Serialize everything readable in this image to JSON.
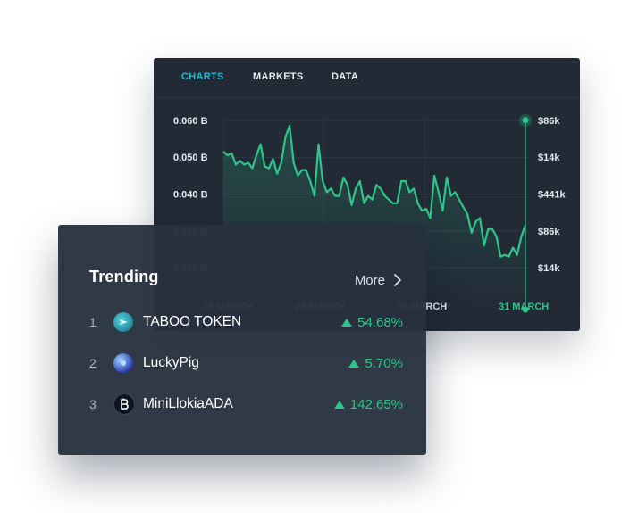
{
  "tabs": [
    {
      "label": "CHARTS",
      "active": true
    },
    {
      "label": "MARKETS",
      "active": false
    },
    {
      "label": "DATA",
      "active": false
    }
  ],
  "chart_data": {
    "type": "line",
    "y_ticks": [
      "0.060 B",
      "0.050 B",
      "0.040 B",
      "0.030 B",
      "0.020 B"
    ],
    "y_values": [
      0.06,
      0.05,
      0.04,
      0.03,
      0.02
    ],
    "ylim": [
      0.014,
      0.066
    ],
    "right_ticks": [
      "$86k",
      "$14k",
      "$441k",
      "$86k",
      "$14k"
    ],
    "x_ticks": [
      "28 MARCH",
      "29 MARCH",
      "30 MARCH",
      "31 MARCH"
    ],
    "highlighted_x_tick": "31 MARCH",
    "grid": true,
    "series": [
      {
        "color": "#2ec58a",
        "values": [
          0.0515,
          0.0505,
          0.051,
          0.048,
          0.049,
          0.048,
          0.0485,
          0.047,
          0.0505,
          0.0535,
          0.0475,
          0.047,
          0.0495,
          0.0455,
          0.0485,
          0.0555,
          0.0585,
          0.0485,
          0.045,
          0.0465,
          0.0465,
          0.0435,
          0.0395,
          0.0535,
          0.0435,
          0.0405,
          0.0415,
          0.0395,
          0.0395,
          0.0445,
          0.0425,
          0.037,
          0.0415,
          0.0435,
          0.0375,
          0.0395,
          0.0385,
          0.0425,
          0.0415,
          0.0395,
          0.0385,
          0.0375,
          0.0375,
          0.0435,
          0.0435,
          0.0405,
          0.0415,
          0.0375,
          0.0355,
          0.036,
          0.0335,
          0.045,
          0.0405,
          0.0355,
          0.0445,
          0.0395,
          0.0405,
          0.0385,
          0.0365,
          0.0345,
          0.0295,
          0.0325,
          0.0335,
          0.026,
          0.0305,
          0.0305,
          0.0285,
          0.023,
          0.0235,
          0.023,
          0.0255,
          0.0235,
          0.0285,
          0.0315
        ]
      }
    ],
    "marker_value": 0.06
  },
  "trending": {
    "title": "Trending",
    "more_label": "More",
    "items": [
      {
        "rank": "1",
        "name": "TABOO TOKEN",
        "change": "54.68%",
        "icon": "taboo-token-icon",
        "icon_color": "#1b8fa6"
      },
      {
        "rank": "2",
        "name": "LuckyPig",
        "change": "5.70%",
        "icon": "luckypig-icon",
        "icon_color": "#3a5fd8"
      },
      {
        "rank": "3",
        "name": "MiniLlokiaADA",
        "change": "142.65%",
        "icon": "minillokiaada-icon",
        "icon_color": "#101826"
      }
    ]
  },
  "colors": {
    "accent": "#22b8cf",
    "positive": "#2ec58a",
    "card_bg": "#222a36"
  }
}
